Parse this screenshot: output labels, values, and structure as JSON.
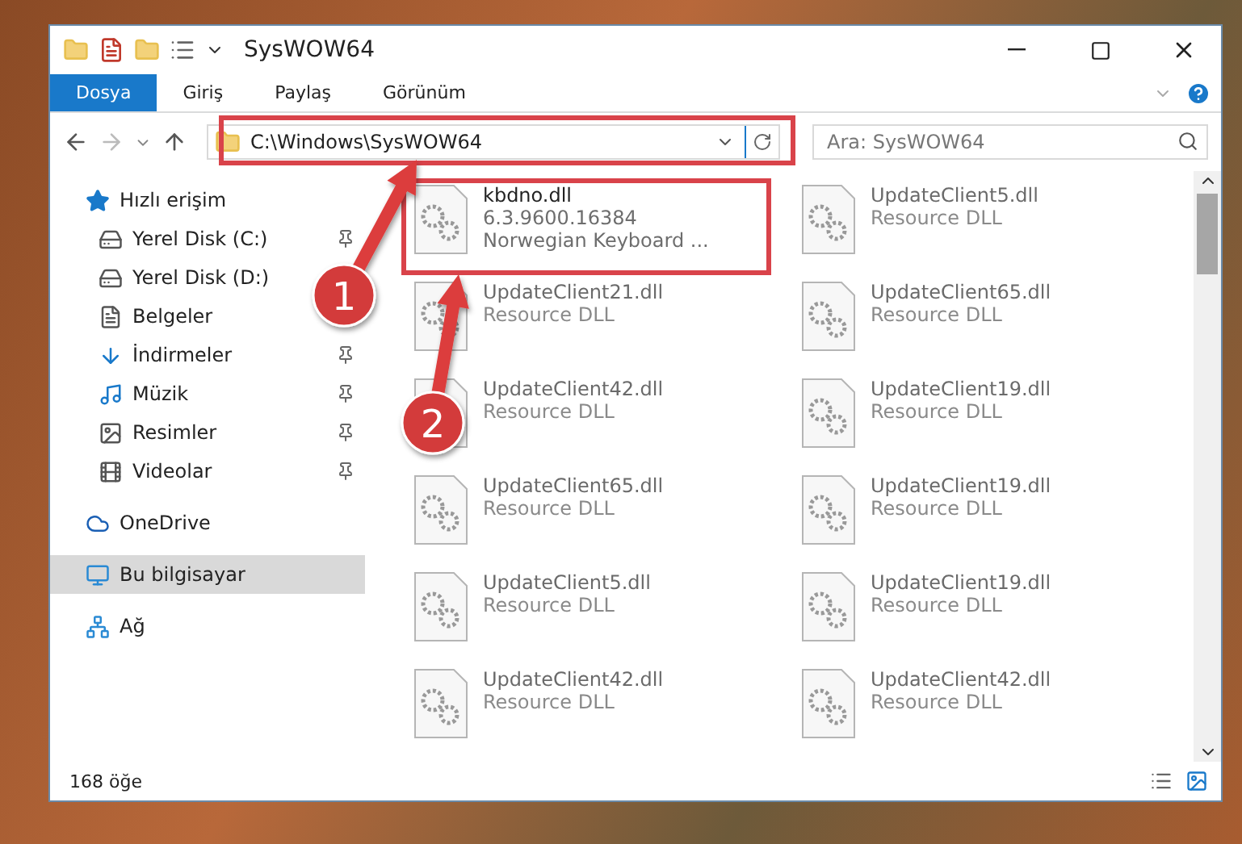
{
  "window": {
    "title": "SysWOW64"
  },
  "ribbon_tabs": [
    {
      "label": "Dosya",
      "selected": true
    },
    {
      "label": "Giriş",
      "selected": false
    },
    {
      "label": "Paylaş",
      "selected": false
    },
    {
      "label": "Görünüm",
      "selected": false
    }
  ],
  "address_bar": {
    "path": "C:\\Windows\\SysWOW64"
  },
  "search": {
    "placeholder": "Ara: SysWOW64"
  },
  "sidebar": {
    "items": [
      {
        "label": "Hızlı erişim",
        "selected": false,
        "children": [
          {
            "label": "Yerel Disk (C:)",
            "pinned": true,
            "selected": false
          },
          {
            "label": "Yerel Disk (D:)",
            "pinned": false,
            "selected": false
          },
          {
            "label": "Belgeler",
            "pinned": false,
            "selected": false
          },
          {
            "label": "İndirmeler",
            "pinned": true,
            "selected": false
          },
          {
            "label": "Müzik",
            "pinned": true,
            "selected": false
          },
          {
            "label": "Resimler",
            "pinned": true,
            "selected": false
          },
          {
            "label": "Videolar",
            "pinned": true,
            "selected": false
          }
        ]
      },
      {
        "label": "OneDrive",
        "selected": false
      },
      {
        "label": "Bu bilgisayar",
        "selected": true
      },
      {
        "label": "Ağ",
        "selected": false
      }
    ]
  },
  "files": [
    {
      "name": "kbdno.dll",
      "version": "6.3.9600.16384",
      "description": "Norwegian Keyboard ...",
      "faded": false
    },
    {
      "name": "UpdateClient5.dll",
      "description": "Resource DLL",
      "faded": true
    },
    {
      "name": "UpdateClient21.dll",
      "description": "Resource DLL",
      "faded": true
    },
    {
      "name": "UpdateClient65.dll",
      "description": "Resource DLL",
      "faded": true
    },
    {
      "name": "UpdateClient42.dll",
      "description": "Resource DLL",
      "faded": true
    },
    {
      "name": "UpdateClient19.dll",
      "description": "Resource DLL",
      "faded": true
    },
    {
      "name": "UpdateClient65.dll",
      "description": "Resource DLL",
      "faded": true
    },
    {
      "name": "UpdateClient19.dll",
      "description": "Resource DLL",
      "faded": true
    },
    {
      "name": "UpdateClient5.dll",
      "description": "Resource DLL",
      "faded": true
    },
    {
      "name": "UpdateClient19.dll",
      "description": "Resource DLL",
      "faded": true
    },
    {
      "name": "UpdateClient42.dll",
      "description": "Resource DLL",
      "faded": true
    },
    {
      "name": "UpdateClient42.dll",
      "description": "Resource DLL",
      "faded": true
    }
  ],
  "status_bar": {
    "count": "168 öğe"
  },
  "annotations": [
    {
      "label": "1"
    },
    {
      "label": "2"
    }
  ]
}
